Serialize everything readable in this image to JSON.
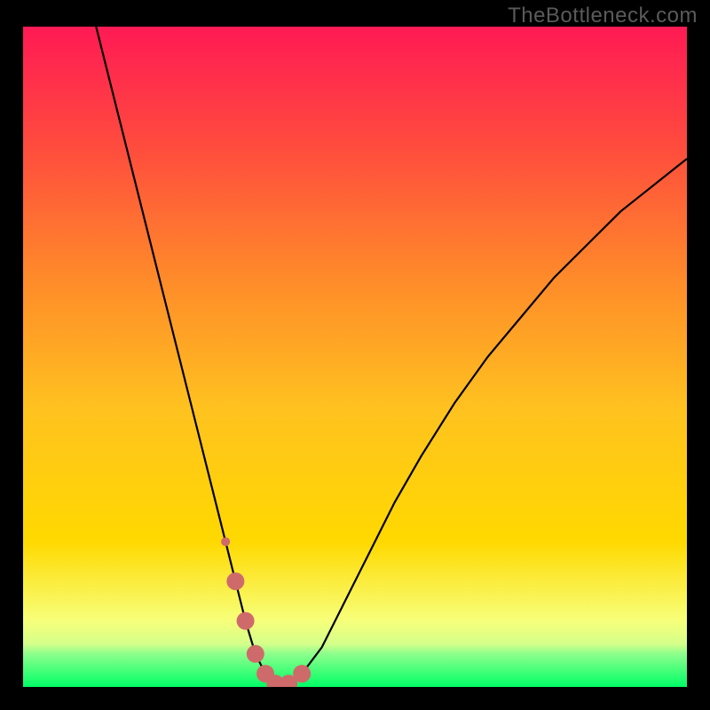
{
  "watermark": "TheBottleneck.com",
  "chart_data": {
    "type": "line",
    "title": "",
    "xlabel": "",
    "ylabel": "",
    "xlim": [
      0,
      100
    ],
    "ylim": [
      0,
      100
    ],
    "grid": false,
    "legend": false,
    "background_gradient": {
      "top_color": "#ff1a54",
      "mid_color": "#ffd900",
      "bottom_band_color": "#00ff66",
      "bottom_band_start": 94
    },
    "series": [
      {
        "name": "bottleneck-curve",
        "stroke": "#000000",
        "stroke_width": 2.2,
        "x": [
          11,
          13,
          15,
          17,
          19,
          21,
          23,
          25,
          27,
          29,
          30.5,
          32,
          33.5,
          35,
          36.5,
          38,
          40,
          42,
          45,
          48,
          52,
          56,
          60,
          65,
          70,
          75,
          80,
          85,
          90,
          95,
          100
        ],
        "y": [
          100,
          92,
          84,
          76,
          68,
          60,
          52,
          44,
          36,
          28,
          22,
          16,
          10,
          5,
          2,
          0.5,
          0.5,
          2,
          6,
          12,
          20,
          28,
          35,
          43,
          50,
          56,
          62,
          67,
          72,
          76,
          80
        ]
      }
    ],
    "markers": {
      "name": "highlight-dots",
      "color": "#cf6a6a",
      "radius_small": 5,
      "radius_large": 10,
      "points_x": [
        30.5,
        32,
        33.5,
        35,
        36.5,
        38,
        40,
        42
      ],
      "points_r": [
        5,
        10,
        10,
        10,
        10,
        10,
        10,
        10
      ]
    }
  }
}
